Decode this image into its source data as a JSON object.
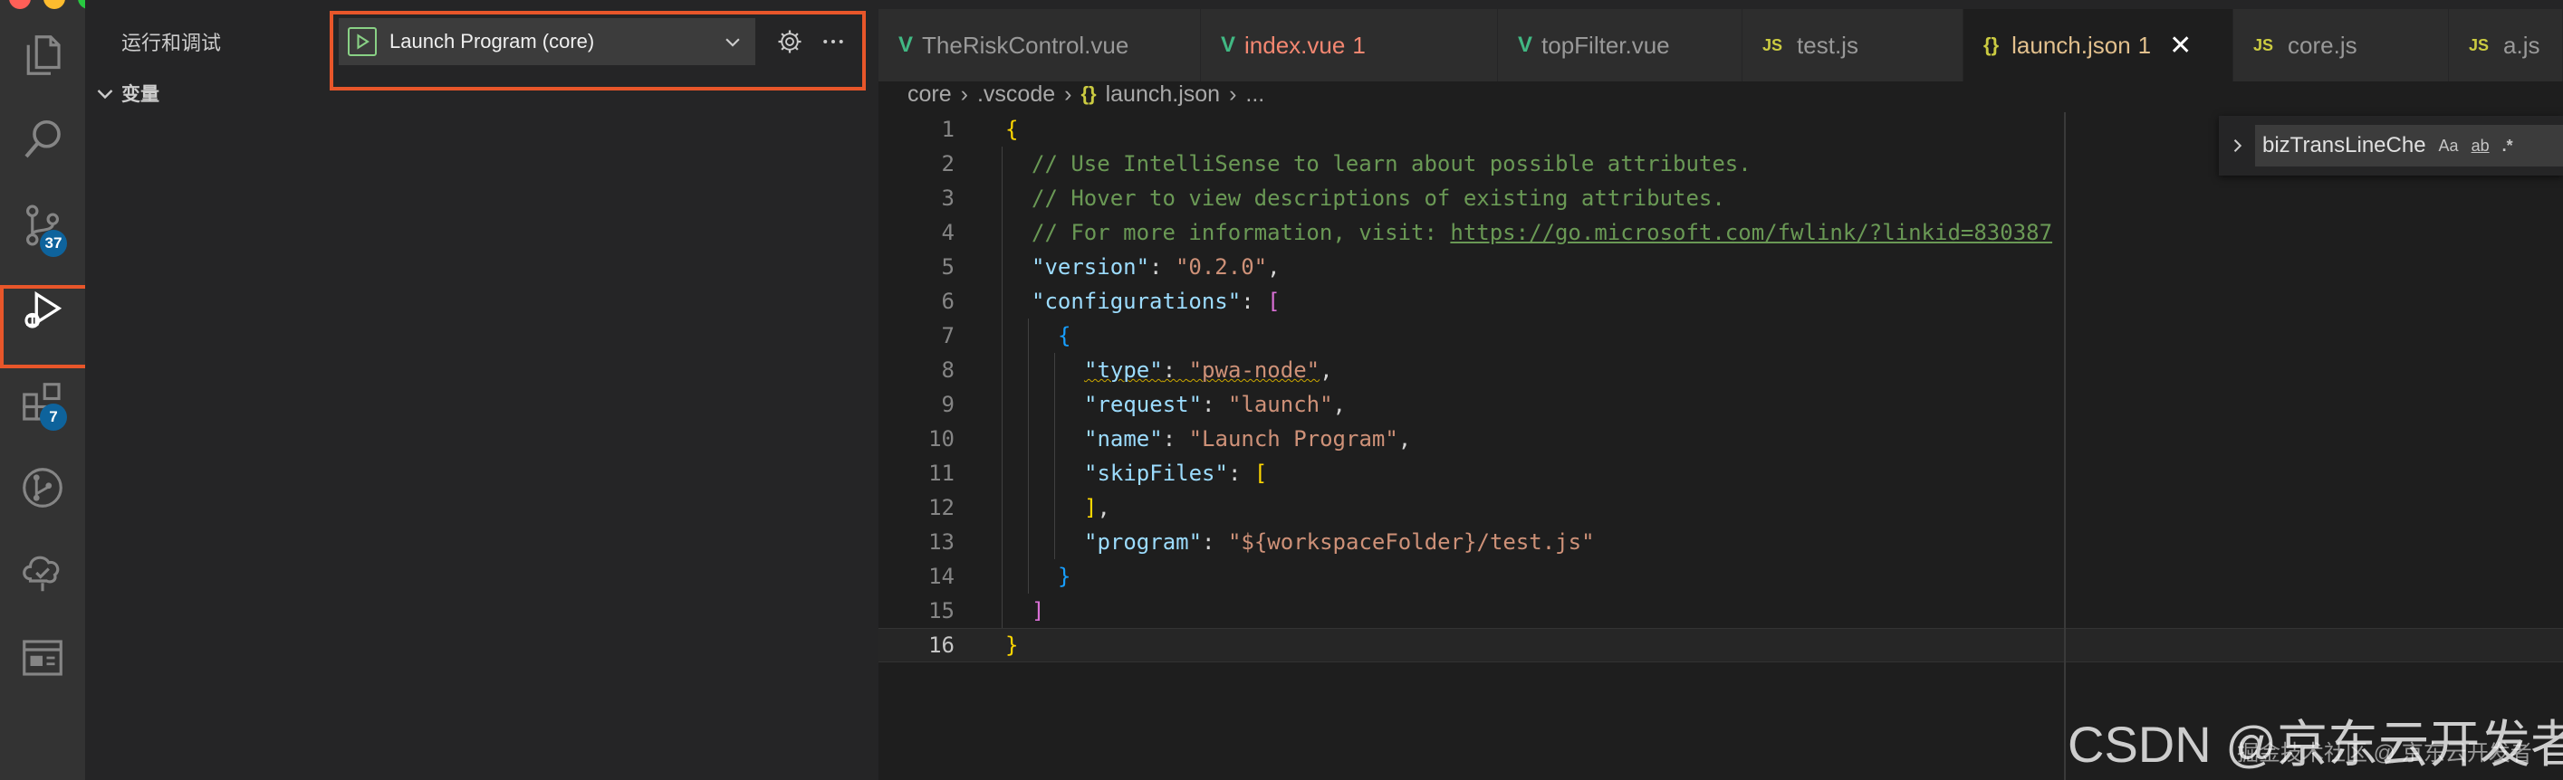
{
  "activity_bar": {
    "items": [
      {
        "icon": "explorer-icon"
      },
      {
        "icon": "search-icon"
      },
      {
        "icon": "source-control-icon",
        "badge": "37"
      },
      {
        "icon": "run-debug-icon"
      },
      {
        "icon": "extensions-icon",
        "badge": "7"
      },
      {
        "icon": "git-graph-icon"
      },
      {
        "icon": "testing-icon"
      },
      {
        "icon": "browser-preview-icon"
      }
    ]
  },
  "sidebar": {
    "title": "运行和调试",
    "debug_config": "Launch Program (core)",
    "section": "变量"
  },
  "tabs": [
    {
      "label": "TheRiskControl.vue",
      "icon": "vue"
    },
    {
      "label": "index.vue",
      "icon": "vue",
      "count": "1",
      "modified": true
    },
    {
      "label": "topFilter.vue",
      "icon": "vue"
    },
    {
      "label": "test.js",
      "icon": "js"
    },
    {
      "label": "launch.json",
      "icon": "json",
      "count": "1",
      "active": true
    },
    {
      "label": "core.js",
      "icon": "js"
    },
    {
      "label": "a.js",
      "icon": "js"
    }
  ],
  "icon_labels": {
    "js": "JS",
    "json": "{}",
    "vue": "V"
  },
  "breadcrumb": {
    "parts": [
      "core",
      ".vscode",
      "launch.json",
      "..."
    ]
  },
  "code": {
    "line_numbers": [
      "1",
      "2",
      "3",
      "4",
      "5",
      "6",
      "7",
      "8",
      "9",
      "10",
      "11",
      "12",
      "13",
      "14",
      "15",
      "16"
    ],
    "current_line": 16,
    "lines": [
      {
        "indent": 0,
        "tokens": [
          {
            "c": "c-brace",
            "t": "{"
          }
        ]
      },
      {
        "indent": 1,
        "tokens": [
          {
            "c": "c-comment",
            "t": "// Use IntelliSense to learn about possible attributes."
          }
        ]
      },
      {
        "indent": 1,
        "tokens": [
          {
            "c": "c-comment",
            "t": "// Hover to view descriptions of existing attributes."
          }
        ]
      },
      {
        "indent": 1,
        "tokens": [
          {
            "c": "c-comment",
            "t": "// For more information, visit: "
          },
          {
            "c": "c-link",
            "t": "https://go.microsoft.com/fwlink/?linkid=830387"
          }
        ]
      },
      {
        "indent": 1,
        "tokens": [
          {
            "c": "c-key",
            "t": "\"version\""
          },
          {
            "c": "c-punc",
            "t": ": "
          },
          {
            "c": "c-str",
            "t": "\"0.2.0\""
          },
          {
            "c": "c-punc",
            "t": ","
          }
        ]
      },
      {
        "indent": 1,
        "tokens": [
          {
            "c": "c-key",
            "t": "\"configurations\""
          },
          {
            "c": "c-punc",
            "t": ": "
          },
          {
            "c": "c-bracket",
            "t": "["
          }
        ]
      },
      {
        "indent": 2,
        "tokens": [
          {
            "c": "c-brace2",
            "t": "{"
          }
        ]
      },
      {
        "indent": 3,
        "tokens": [
          {
            "c": "c-key squiggle",
            "t": "\"type\""
          },
          {
            "c": "c-punc squiggle",
            "t": ": "
          },
          {
            "c": "c-str squiggle",
            "t": "\"pwa-node\""
          },
          {
            "c": "c-punc",
            "t": ","
          }
        ]
      },
      {
        "indent": 3,
        "tokens": [
          {
            "c": "c-key",
            "t": "\"request\""
          },
          {
            "c": "c-punc",
            "t": ": "
          },
          {
            "c": "c-str",
            "t": "\"launch\""
          },
          {
            "c": "c-punc",
            "t": ","
          }
        ]
      },
      {
        "indent": 3,
        "tokens": [
          {
            "c": "c-key",
            "t": "\"name\""
          },
          {
            "c": "c-punc",
            "t": ": "
          },
          {
            "c": "c-str",
            "t": "\"Launch Program\""
          },
          {
            "c": "c-punc",
            "t": ","
          }
        ]
      },
      {
        "indent": 3,
        "tokens": [
          {
            "c": "c-key",
            "t": "\"skipFiles\""
          },
          {
            "c": "c-punc",
            "t": ": "
          },
          {
            "c": "c-brkt3",
            "t": "["
          }
        ]
      },
      {
        "indent": 3,
        "tokens": [
          {
            "c": "c-brkt3",
            "t": "]"
          },
          {
            "c": "c-punc",
            "t": ","
          }
        ]
      },
      {
        "indent": 3,
        "tokens": [
          {
            "c": "c-key",
            "t": "\"program\""
          },
          {
            "c": "c-punc",
            "t": ": "
          },
          {
            "c": "c-str",
            "t": "\"${workspaceFolder}/test.js\""
          }
        ]
      },
      {
        "indent": 2,
        "tokens": [
          {
            "c": "c-brace2",
            "t": "}"
          }
        ]
      },
      {
        "indent": 1,
        "tokens": [
          {
            "c": "c-bracket",
            "t": "]"
          }
        ]
      },
      {
        "indent": 0,
        "tokens": [
          {
            "c": "c-brace",
            "t": "}"
          }
        ]
      }
    ]
  },
  "find_widget": {
    "query": "bizTransLineChe",
    "opt_case": "Aa",
    "opt_word": "ab",
    "opt_regex": ".*"
  },
  "watermark": {
    "main": "CSDN @京东云开发者",
    "sub": "掘金技术社区 @ 京东云开发者"
  },
  "colors": {
    "highlight": "#e8562a",
    "badge": "#0e639c",
    "start_green": "#89d185"
  }
}
